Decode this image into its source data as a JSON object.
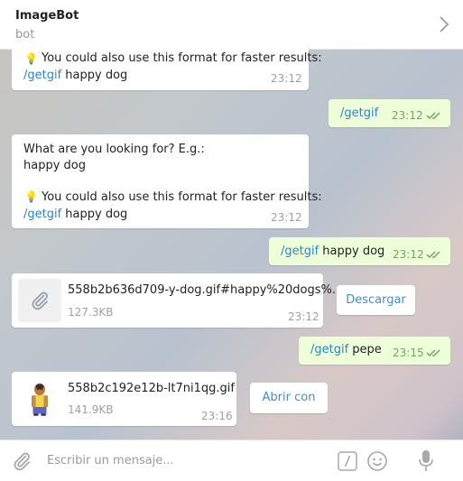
{
  "header": {
    "title": "ImageBot",
    "subtitle": "bot"
  },
  "messages": {
    "m1": {
      "line1": "You could also use this format for faster results:",
      "cmd": "/getgif",
      "rest": " happy dog",
      "time": "23:12"
    },
    "m2": {
      "cmd": "/getgif",
      "time": "23:12"
    },
    "m3": {
      "line1": "What are you looking for? E.g.:",
      "line2": "happy dog",
      "line3": "You could also use this format for faster results:",
      "cmd": "/getgif",
      "rest": " happy dog",
      "time": "23:12"
    },
    "m4": {
      "cmd": "/getgif",
      "rest": " happy dog",
      "time": "23:12"
    },
    "m5": {
      "filename": "558b2b636d709-y-dog.gif#happy%20dogs%...",
      "size": "127.3KB",
      "time": "23:12",
      "action": "Descargar"
    },
    "m6": {
      "cmd": "/getgif",
      "rest": " pepe",
      "time": "23:15"
    },
    "m7": {
      "filename": "558b2c192e12b-lt7ni1qg.gif",
      "size": "141.9KB",
      "time": "23:16",
      "action": "Abrir con"
    }
  },
  "composer": {
    "placeholder": "Escribir un mensaje..."
  },
  "colors": {
    "link": "#2a86c8",
    "outgoing_bubble": "#eefed9",
    "check": "#6dab5b"
  }
}
